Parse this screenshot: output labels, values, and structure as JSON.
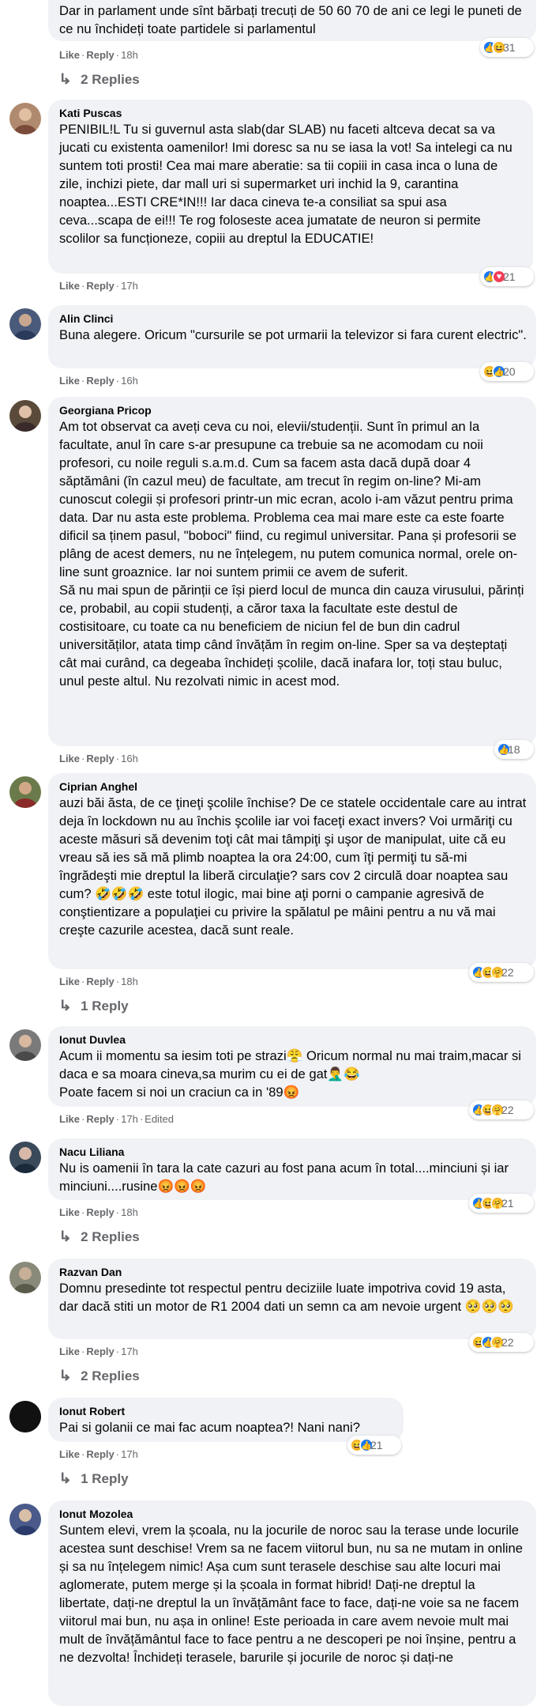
{
  "comments": [
    {
      "author": "",
      "text": "Dar in parlament unde sînt bărbați trecuți de 50 60 70 de ani ce legi le puneti de ce nu închideți toate partidele si parlamentul",
      "like": "Like",
      "reply": "Reply",
      "time": "18h",
      "edited": "",
      "reactions": [
        "like",
        "haha"
      ],
      "reaction_count": "31",
      "replies": "2 Replies",
      "avatar_color": "#8a7a6a"
    },
    {
      "author": "Kati Puscas",
      "text": "PENIBIL!L Tu si guvernul asta slab(dar SLAB) nu faceti altceva decat sa va jucati cu existenta oamenilor! Imi doresc sa nu se iasa la vot! Sa intelegi ca nu suntem toti prosti! Cea mai mare aberatie: sa tii copiii in casa inca o luna de zile, inchizi piete, dar mall uri si supermarket uri inchid la 9, carantina noaptea...ESTI CRE*IN!!! Iar daca cineva te-a consiliat sa spui asa ceva...scapa de ei!!! Te rog foloseste acea jumatate de neuron si permite scolilor sa funcționeze, copiii au dreptul la EDUCATIE!",
      "like": "Like",
      "reply": "Reply",
      "time": "17h",
      "edited": "",
      "reactions": [
        "like",
        "love"
      ],
      "reaction_count": "21",
      "replies": "",
      "avatar_color": "#b08a6e"
    },
    {
      "author": "Alin Clinci",
      "text": "Buna alegere. Oricum \"cursurile se pot urmarii la televizor si fara curent electric\".",
      "like": "Like",
      "reply": "Reply",
      "time": "16h",
      "edited": "",
      "reactions": [
        "haha",
        "like"
      ],
      "reaction_count": "20",
      "replies": "",
      "avatar_color": "#4a5a7a"
    },
    {
      "author": "Georgiana Pricop",
      "text": "Am tot observat ca aveți ceva cu noi, elevii/studenții. Sunt în primul an la facultate, anul în care s-ar presupune ca trebuie sa ne acomodam cu noii profesori, cu noile reguli s.a.m.d. Cum sa facem asta dacă după doar 4 săptămâni (în cazul meu) de facultate, am trecut în regim on-line? Mi-am cunoscut colegii și profesori printr-un mic ecran, acolo i-am văzut pentru prima data. Dar nu asta este problema. Problema cea mai mare este ca este foarte dificil sa ținem pasul, \"boboci\" fiind, cu regimul universitar. Pana și profesorii se plâng de acest demers, nu ne înțelegem, nu putem comunica normal, orele on-line sunt groaznice. Iar noi suntem primii ce avem de suferit.\nSă nu mai spun de părinții ce își pierd locul de munca din cauza virusului, părinți ce, probabil, au copii studenți, a căror taxa la facultate este destul de costisitoare, cu toate ca nu beneficiem de niciun fel de bun din cadrul universităților, atata timp când învățăm în regim on-line. Sper sa va deșteptați cât mai curând, ca degeaba închideți școlile, dacă inafara lor, toți stau buluc, unul peste altul. Nu rezolvati nimic in acest mod.",
      "like": "Like",
      "reply": "Reply",
      "time": "16h",
      "edited": "",
      "reactions": [
        "like"
      ],
      "reaction_count": "18",
      "replies": "",
      "avatar_color": "#5a4a3a"
    },
    {
      "author": "Ciprian Anghel",
      "text": "auzi băi ăsta, de ce ţineţi şcolile închise? De ce statele occidentale care au intrat deja în lockdown nu au închis şcolile iar voi faceţi exact invers? Voi urmăriţi cu aceste măsuri să devenim toţi cât mai tâmpiţi şi uşor de manipulat, uite că eu vreau să ies să mă plimb noaptea la ora 24:00, cum îţi permiţi tu să-mi îngrădeşti mie dreptul la liberă circulaţie? sars cov 2 circulă doar noaptea sau cum? 🤣🤣🤣 este totul ilogic, mai bine aţi porni o campanie agresivă de conştientizare a populaţiei cu privire la spălatul pe mâini pentru a nu vă mai creşte cazurile acestea, dacă sunt reale.",
      "like": "Like",
      "reply": "Reply",
      "time": "18h",
      "edited": "",
      "reactions": [
        "like",
        "haha",
        "care"
      ],
      "reaction_count": "22",
      "replies": "1 Reply",
      "avatar_color": "#6a7a4a"
    },
    {
      "author": "Ionut Duvlea",
      "text": "Acum ii momentu sa iesim toti pe strazi😤 Oricum normal nu mai traim,macar si daca e sa moara cineva,sa murim cu ei de gat🤦‍♂️😂\nPoate facem si noi un craciun ca in '89😡",
      "like": "Like",
      "reply": "Reply",
      "time": "17h",
      "edited": "Edited",
      "reactions": [
        "like",
        "haha",
        "care"
      ],
      "reaction_count": "22",
      "replies": "",
      "avatar_color": "#7a7a7a"
    },
    {
      "author": "Nacu Liliana",
      "text": "Nu is oamenii în tara la cate cazuri au fost pana acum în total....minciuni și iar minciuni....rusine😡😡😡",
      "like": "Like",
      "reply": "Reply",
      "time": "18h",
      "edited": "",
      "reactions": [
        "like",
        "haha",
        "care"
      ],
      "reaction_count": "21",
      "replies": "2 Replies",
      "avatar_color": "#3a4a5a"
    },
    {
      "author": "Razvan Dan",
      "text": "Domnu presedinte tot respectul pentru deciziile luate impotriva covid 19 asta, dar dacă stiti un motor de R1 2004 dati un semn ca am nevoie urgent 🥺🥺🥺",
      "like": "Like",
      "reply": "Reply",
      "time": "17h",
      "edited": "",
      "reactions": [
        "haha",
        "like",
        "care"
      ],
      "reaction_count": "22",
      "replies": "2 Replies",
      "avatar_color": "#8a8a7a"
    },
    {
      "author": "Ionut Robert",
      "text": "Pai si golanii ce mai fac acum noaptea?! Nani nani?",
      "like": "Like",
      "reply": "Reply",
      "time": "17h",
      "edited": "",
      "reactions": [
        "haha",
        "like"
      ],
      "reaction_count": "21",
      "replies": "1 Reply",
      "avatar_color": "#111111"
    },
    {
      "author": "Ionut Mozolea",
      "text": "Suntem elevi, vrem la școala, nu la jocurile de noroc sau la terase unde locurile acestea sunt deschise! Vrem sa ne facem viitorul bun, nu sa ne mutam in online și sa nu înțelegem nimic! Așa cum sunt terasele deschise sau alte locuri mai aglomerate, putem merge și la școala in format hibrid! Dați-ne dreptul la libertate, dați-ne dreptul la un învățământ face to face, dați-ne voie sa ne facem viitorul mai bun, nu așa in online! Este perioada in care avem nevoie mult mai mult de învățământul face to face pentru a ne descoperi pe noi înșine, pentru a ne dezvolta! Închideți terasele, barurile și jocurile de noroc și dați-ne",
      "like": "",
      "reply": "",
      "time": "",
      "edited": "",
      "reactions": [],
      "reaction_count": "",
      "replies": "",
      "avatar_color": "#4a5a8a"
    }
  ]
}
